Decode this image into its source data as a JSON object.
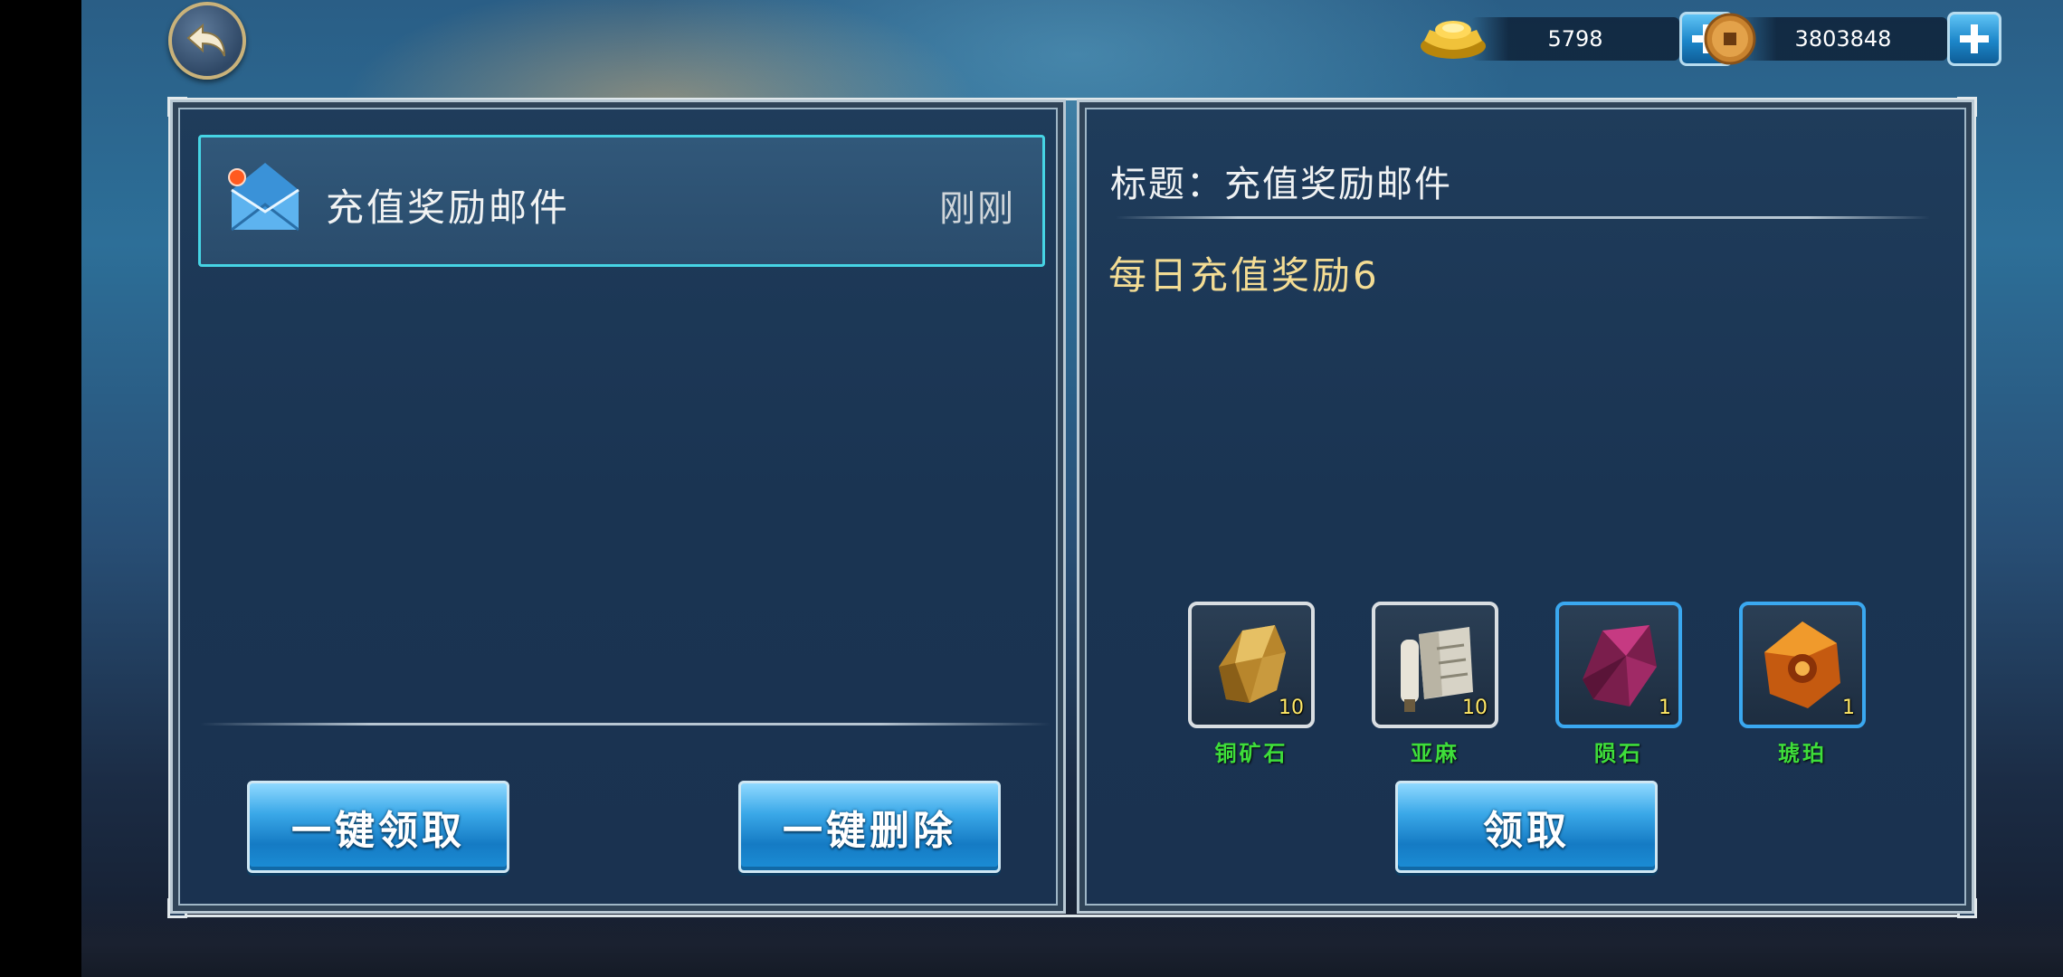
{
  "currency": {
    "gold_ingot": {
      "icon": "gold-ingot-icon",
      "amount": "5798"
    },
    "copper_coin": {
      "icon": "copper-coin-icon",
      "amount": "3803848"
    }
  },
  "mail_list": {
    "items": [
      {
        "title": "充值奖励邮件",
        "time": "刚刚",
        "unread": true
      }
    ],
    "claim_all_label": "一键领取",
    "delete_all_label": "一键删除"
  },
  "mail_detail": {
    "title": "标题：充值奖励邮件",
    "body": "每日充值奖励6",
    "rewards": [
      {
        "name": "铜矿石",
        "quantity": "10",
        "icon": "copper-ore-icon",
        "rarity": "white"
      },
      {
        "name": "亚麻",
        "quantity": "10",
        "icon": "linen-scroll-icon",
        "rarity": "white"
      },
      {
        "name": "陨石",
        "quantity": "1",
        "icon": "meteorite-icon",
        "rarity": "blue"
      },
      {
        "name": "琥珀",
        "quantity": "1",
        "icon": "amber-icon",
        "rarity": "blue"
      }
    ],
    "claim_label": "领取"
  },
  "colors": {
    "panel_bg": "#1a3452",
    "selected_border": "#46d4e4",
    "body_text": "#f3dc94",
    "reward_name": "#3ede3a",
    "button_blue": "#1c8ed6"
  }
}
